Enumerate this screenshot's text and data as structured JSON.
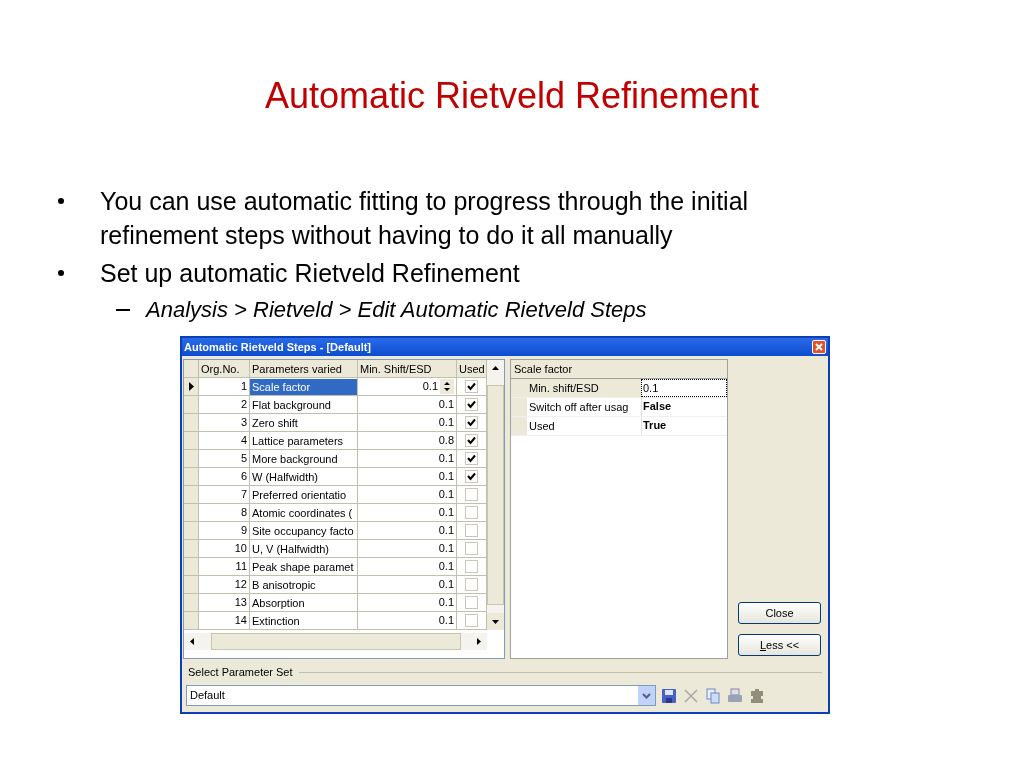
{
  "slide": {
    "title": "Automatic Rietveld Refinement",
    "bullets": [
      {
        "text": "You can use automatic fitting to progress through the initial refinement steps without having to do it all manually"
      },
      {
        "text": "Set up automatic Rietveld Refinement",
        "children": [
          {
            "text": "Analysis > Rietveld > Edit Automatic Rietveld Steps"
          }
        ]
      }
    ]
  },
  "dialog": {
    "title": "Automatic Rietveld Steps - [Default]",
    "grid": {
      "columns": [
        "Org.No.",
        "Parameters varied",
        "Min. Shift/ESD",
        "Used"
      ],
      "rows": [
        {
          "org_no": "1",
          "parameter": "Scale factor",
          "min_shift": "0.1",
          "used": true,
          "selected": true
        },
        {
          "org_no": "2",
          "parameter": "Flat background",
          "min_shift": "0.1",
          "used": true,
          "selected": false
        },
        {
          "org_no": "3",
          "parameter": "Zero shift",
          "min_shift": "0.1",
          "used": true,
          "selected": false
        },
        {
          "org_no": "4",
          "parameter": "Lattice parameters",
          "min_shift": "0.8",
          "used": true,
          "selected": false
        },
        {
          "org_no": "5",
          "parameter": "More background",
          "min_shift": "0.1",
          "used": true,
          "selected": false
        },
        {
          "org_no": "6",
          "parameter": "W (Halfwidth)",
          "min_shift": "0.1",
          "used": true,
          "selected": false
        },
        {
          "org_no": "7",
          "parameter": "Preferred orientatio",
          "min_shift": "0.1",
          "used": false,
          "selected": false
        },
        {
          "org_no": "8",
          "parameter": "Atomic coordinates (",
          "min_shift": "0.1",
          "used": false,
          "selected": false
        },
        {
          "org_no": "9",
          "parameter": "Site occupancy facto",
          "min_shift": "0.1",
          "used": false,
          "selected": false
        },
        {
          "org_no": "10",
          "parameter": "U, V (Halfwidth)",
          "min_shift": "0.1",
          "used": false,
          "selected": false
        },
        {
          "org_no": "11",
          "parameter": "Peak shape paramet",
          "min_shift": "0.1",
          "used": false,
          "selected": false
        },
        {
          "org_no": "12",
          "parameter": "B anisotropic",
          "min_shift": "0.1",
          "used": false,
          "selected": false
        },
        {
          "org_no": "13",
          "parameter": "Absorption",
          "min_shift": "0.1",
          "used": false,
          "selected": false
        },
        {
          "org_no": "14",
          "parameter": "Extinction",
          "min_shift": "0.1",
          "used": false,
          "selected": false
        }
      ]
    },
    "properties": {
      "header": "Scale factor",
      "rows": [
        {
          "name": "Min. shift/ESD",
          "value": "0.1",
          "selected": true
        },
        {
          "name": "Switch off after usag",
          "value": "False",
          "selected": false
        },
        {
          "name": "Used",
          "value": "True",
          "selected": false
        }
      ]
    },
    "buttons": [
      "Close",
      "Less <<"
    ],
    "parameter_set": {
      "label": "Select Parameter Set",
      "value": "Default"
    }
  }
}
